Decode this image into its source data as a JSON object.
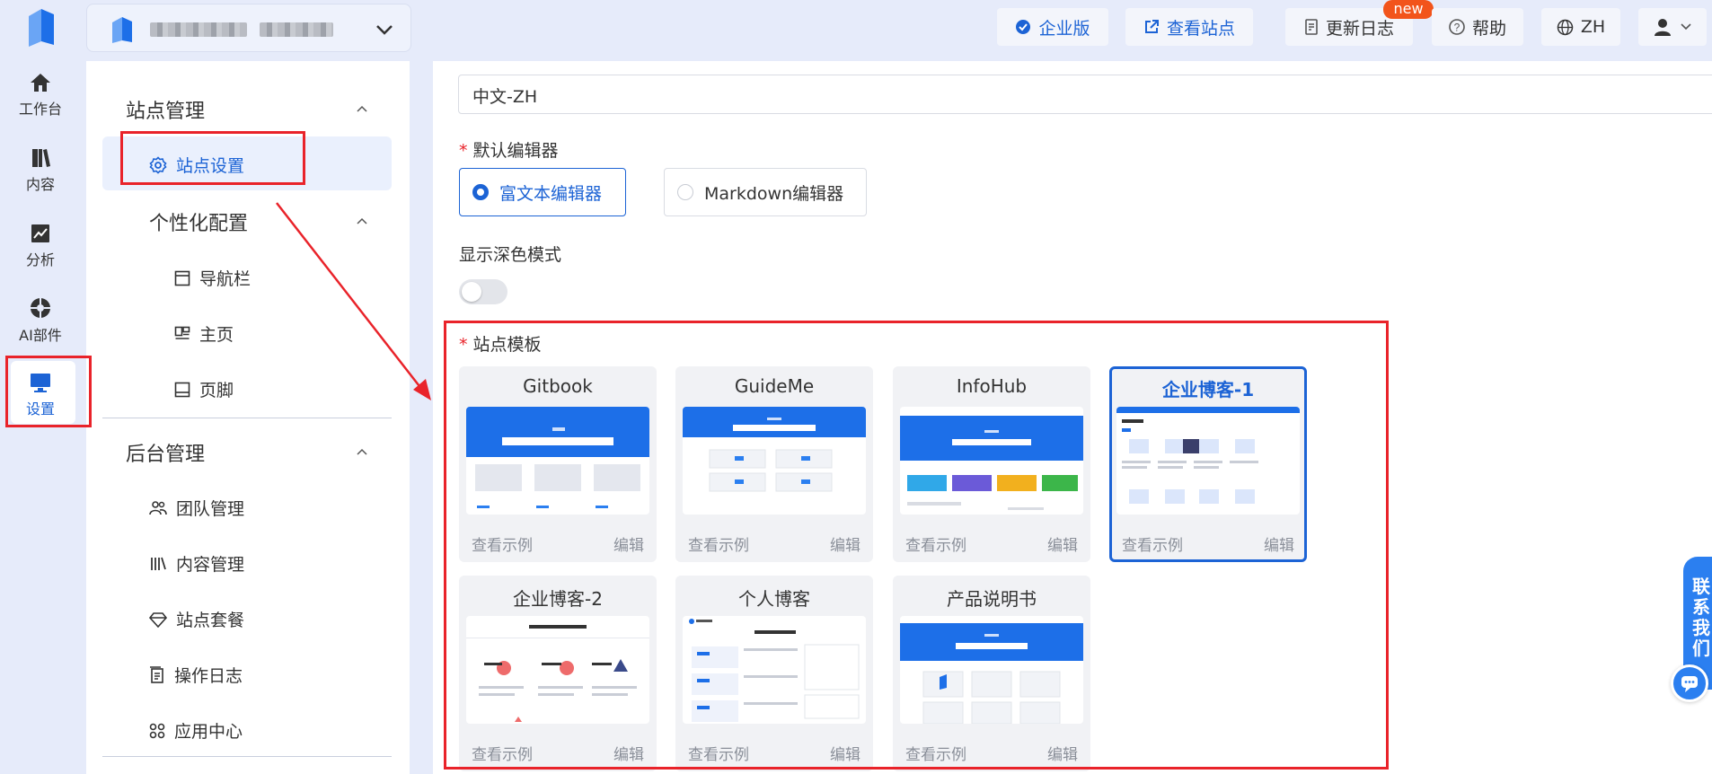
{
  "topbar": {
    "enterprise_label": "企业版",
    "view_site_label": "查看站点",
    "changelog_label": "更新日志",
    "new_badge": "new",
    "help_label": "帮助",
    "lang_label": "ZH"
  },
  "leftnav": {
    "items": [
      {
        "label": "工作台",
        "icon": "home-icon"
      },
      {
        "label": "内容",
        "icon": "book-icon"
      },
      {
        "label": "分析",
        "icon": "chart-icon"
      },
      {
        "label": "AI部件",
        "icon": "ai-widget-icon"
      },
      {
        "label": "设置",
        "icon": "monitor-icon",
        "active": true
      }
    ]
  },
  "sidebar": {
    "section1_title": "站点管理",
    "site_settings": "站点设置",
    "personal_title": "个性化配置",
    "navbar": "导航栏",
    "homepage": "主页",
    "footer": "页脚",
    "section2_title": "后台管理",
    "team": "团队管理",
    "content_mgmt": "内容管理",
    "package": "站点套餐",
    "oplog": "操作日志",
    "appcenter": "应用中心"
  },
  "main": {
    "language_value": "中文-ZH",
    "editor_label": "默认编辑器",
    "editor_options": [
      "富文本编辑器",
      "Markdown编辑器"
    ],
    "dark_mode_label": "显示深色模式",
    "template_label": "站点模板",
    "templates": [
      {
        "name": "Gitbook",
        "demo": "查看示例",
        "edit": "编辑"
      },
      {
        "name": "GuideMe",
        "demo": "查看示例",
        "edit": "编辑"
      },
      {
        "name": "InfoHub",
        "demo": "查看示例",
        "edit": "编辑"
      },
      {
        "name": "企业博客-1",
        "demo": "查看示例",
        "edit": "编辑",
        "selected": true
      },
      {
        "name": "企业博客-2",
        "demo": "查看示例",
        "edit": "编辑"
      },
      {
        "name": "个人博客",
        "demo": "查看示例",
        "edit": "编辑"
      },
      {
        "name": "产品说明书",
        "demo": "查看示例",
        "edit": "编辑"
      }
    ]
  },
  "contact": "联系我们",
  "colors": {
    "accent": "#1c63d5",
    "annotation_red": "#e9232a",
    "nav_bg": "#e6ebfa"
  }
}
